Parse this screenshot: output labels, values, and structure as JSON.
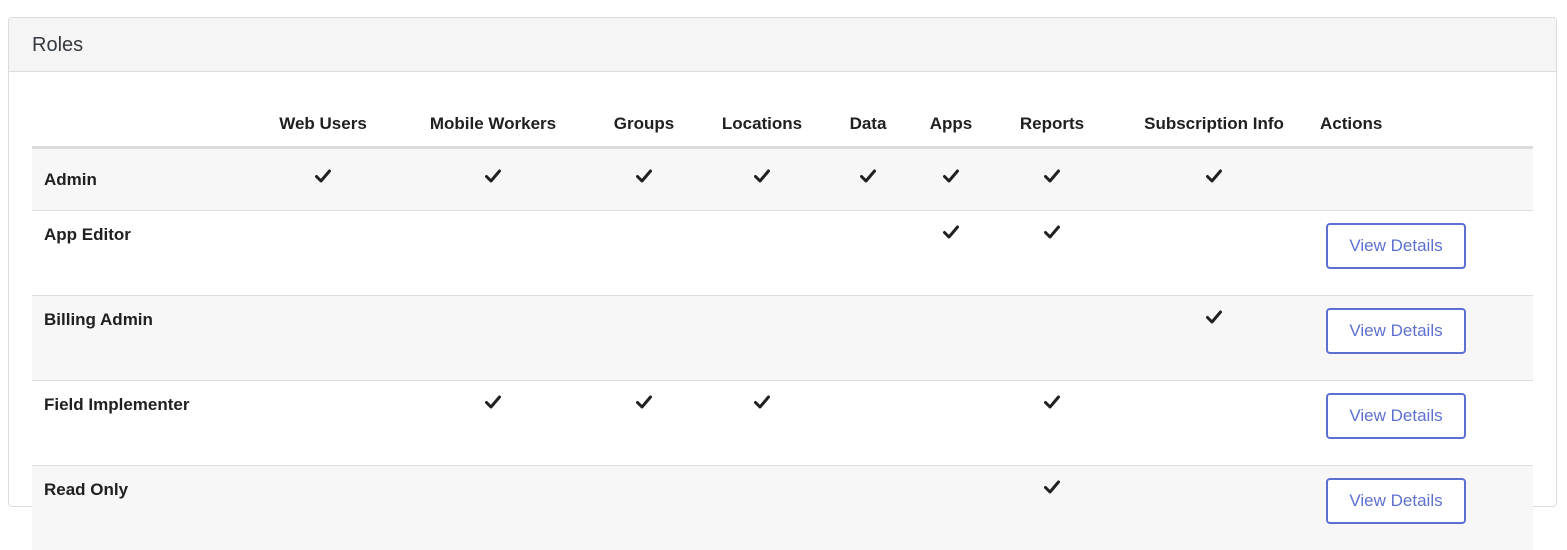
{
  "panel": {
    "title": "Roles"
  },
  "table": {
    "columns": [
      "Web Users",
      "Mobile Workers",
      "Groups",
      "Locations",
      "Data",
      "Apps",
      "Reports",
      "Subscription Info",
      "Actions"
    ],
    "rows": [
      {
        "name": "Admin",
        "perms": [
          true,
          true,
          true,
          true,
          true,
          true,
          true,
          true
        ],
        "action": ""
      },
      {
        "name": "App Editor",
        "perms": [
          false,
          false,
          false,
          false,
          false,
          true,
          true,
          false
        ],
        "action": "View Details"
      },
      {
        "name": "Billing Admin",
        "perms": [
          false,
          false,
          false,
          false,
          false,
          false,
          false,
          true
        ],
        "action": "View Details"
      },
      {
        "name": "Field Implementer",
        "perms": [
          false,
          true,
          true,
          true,
          false,
          false,
          true,
          false
        ],
        "action": "View Details"
      },
      {
        "name": "Read Only",
        "perms": [
          false,
          false,
          false,
          false,
          false,
          false,
          true,
          false
        ],
        "action": "View Details"
      }
    ]
  },
  "icons": {
    "check": "check-icon"
  },
  "colors": {
    "accent": "#5d70d2",
    "stripe": "#f7f7f7",
    "heading_bg": "#f5f5f5"
  }
}
